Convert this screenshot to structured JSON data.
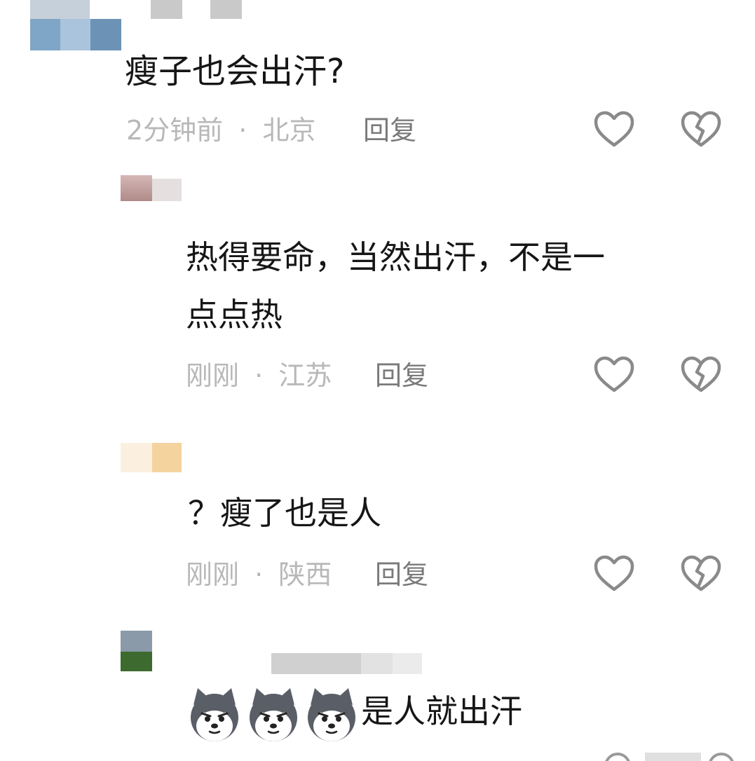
{
  "comments": [
    {
      "text": "瘦子也会出汗?",
      "time": "2分钟前",
      "location": "北京",
      "reply_label": "回复"
    },
    {
      "text_line1": "热得要命，当然出汗，不是一",
      "text_line2": "点点热",
      "time": "刚刚",
      "location": "江苏",
      "reply_label": "回复"
    },
    {
      "text": "？瘦了也是人",
      "time": "刚刚",
      "location": "陕西",
      "reply_label": "回复"
    },
    {
      "text": "是人就出汗",
      "emoji": [
        "husky-emoji",
        "husky-emoji",
        "husky-emoji"
      ]
    }
  ],
  "separator": "·",
  "icons": {
    "like": "heart-outline-icon",
    "dislike": "broken-heart-icon"
  },
  "colors": {
    "meta": "#b8b8b8",
    "reply": "#7a7a7a",
    "icon": "#8a8a8a"
  }
}
